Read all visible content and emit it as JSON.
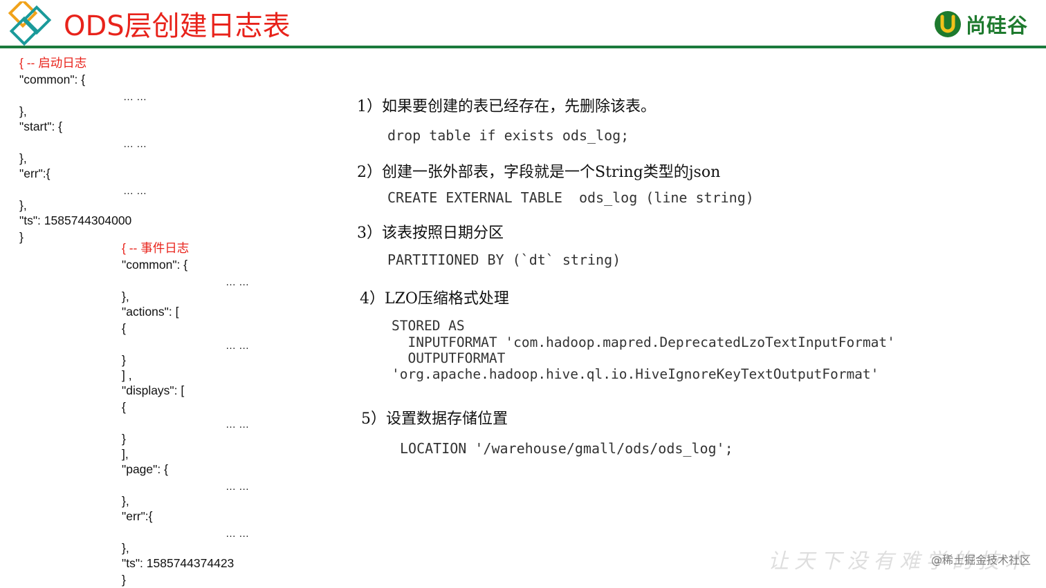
{
  "slide": {
    "title": "ODS层创建日志表",
    "brand_name": "尚硅谷",
    "accent": "#1a7a3c",
    "title_color": "#e8231b"
  },
  "json_sample": {
    "start_log": {
      "comment": "{ -- 启动日志",
      "common": "\"common\": {",
      "common_dots": "… …",
      "close1": "},",
      "start": "\"start\": {",
      "start_dots": "… …",
      "close2": "},",
      "err": "\"err\":{",
      "err_dots": "… …",
      "close3": "},",
      "ts": "\"ts\": 1585744304000",
      "end": "}"
    },
    "event_log": {
      "comment": "{ -- 事件日志",
      "common": "\"common\": {",
      "common_dots": "… …",
      "close1": "},",
      "actions": "\"actions\": [",
      "actions_open": "{",
      "actions_dots": "… …",
      "actions_close": "}",
      "actions_end": "] ,",
      "displays": "\"displays\": [",
      "displays_open": "{",
      "displays_dots": "… …",
      "displays_close": "}",
      "displays_end": "],",
      "page": "\"page\": {",
      "page_dots": "… …",
      "close2": "},",
      "err": "\"err\":{",
      "err_dots": "… …",
      "close3": "},",
      "ts": "\"ts\": 1585744374423",
      "end": "}"
    }
  },
  "steps": [
    {
      "title": "1）如果要创建的表已经存在，先删除该表。",
      "code": "drop table if exists ods_log;"
    },
    {
      "title": "2）创建一张外部表，字段就是一个String类型的json",
      "code": "CREATE EXTERNAL TABLE  ods_log (line string)"
    },
    {
      "title": "3）该表按照日期分区",
      "code": "PARTITIONED BY (`dt` string)"
    },
    {
      "title": "4）LZO压缩格式处理",
      "code_lines": [
        "STORED AS",
        "  INPUTFORMAT 'com.hadoop.mapred.DeprecatedLzoTextInputFormat'",
        "  OUTPUTFORMAT",
        "'org.apache.hadoop.hive.ql.io.HiveIgnoreKeyTextOutputFormat'"
      ]
    },
    {
      "title": "5）设置数据存储位置",
      "code": "LOCATION '/warehouse/gmall/ods/ods_log';"
    }
  ],
  "watermark": {
    "script": "让天下没有难学的技术",
    "text": "@稀土掘金技术社区"
  }
}
